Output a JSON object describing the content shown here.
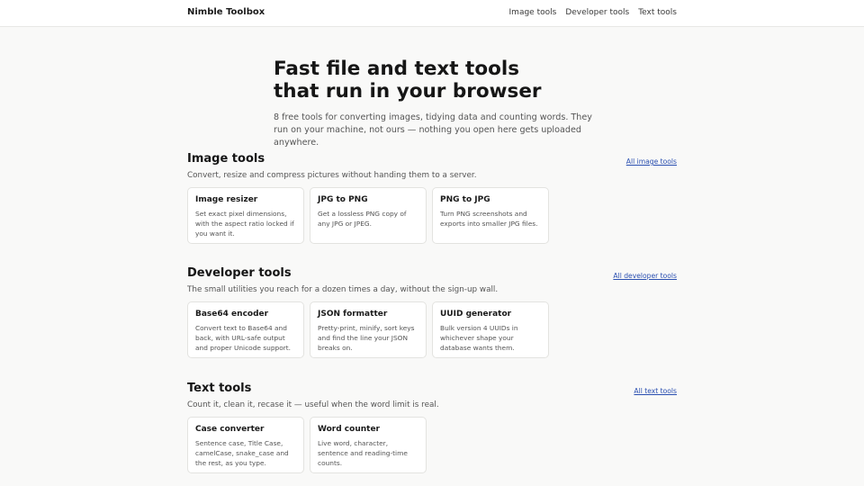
{
  "header": {
    "brand": "Nimble Toolbox",
    "nav": [
      "Image tools",
      "Developer tools",
      "Text tools"
    ]
  },
  "hero": {
    "title_line1": "Fast file and text tools",
    "title_line2": "that run in your browser",
    "subtitle": "8 free tools for converting images, tidying data and counting words. They run on your machine, not ours — nothing you open here gets uploaded anywhere."
  },
  "sections": [
    {
      "title": "Image tools",
      "subtitle": "Convert, resize and compress pictures without handing them to a server.",
      "all_link": "All image tools",
      "cards": [
        {
          "title": "Image resizer",
          "desc": "Set exact pixel dimensions, with the aspect ratio locked if you want it."
        },
        {
          "title": "JPG to PNG",
          "desc": "Get a lossless PNG copy of any JPG or JPEG."
        },
        {
          "title": "PNG to JPG",
          "desc": "Turn PNG screenshots and exports into smaller JPG files."
        }
      ]
    },
    {
      "title": "Developer tools",
      "subtitle": "The small utilities you reach for a dozen times a day, without the sign-up wall.",
      "all_link": "All developer tools",
      "cards": [
        {
          "title": "Base64 encoder",
          "desc": "Convert text to Base64 and back, with URL-safe output and proper Unicode support."
        },
        {
          "title": "JSON formatter",
          "desc": "Pretty-print, minify, sort keys and find the line your JSON breaks on."
        },
        {
          "title": "UUID generator",
          "desc": "Bulk version 4 UUIDs in whichever shape your database wants them."
        }
      ]
    },
    {
      "title": "Text tools",
      "subtitle": "Count it, clean it, recase it — useful when the word limit is real.",
      "all_link": "All text tools",
      "cards": [
        {
          "title": "Case converter",
          "desc": "Sentence case, Title Case, camelCase, snake_case and the rest, as you type."
        },
        {
          "title": "Word counter",
          "desc": "Live word, character, sentence and reading-time counts."
        }
      ]
    }
  ]
}
